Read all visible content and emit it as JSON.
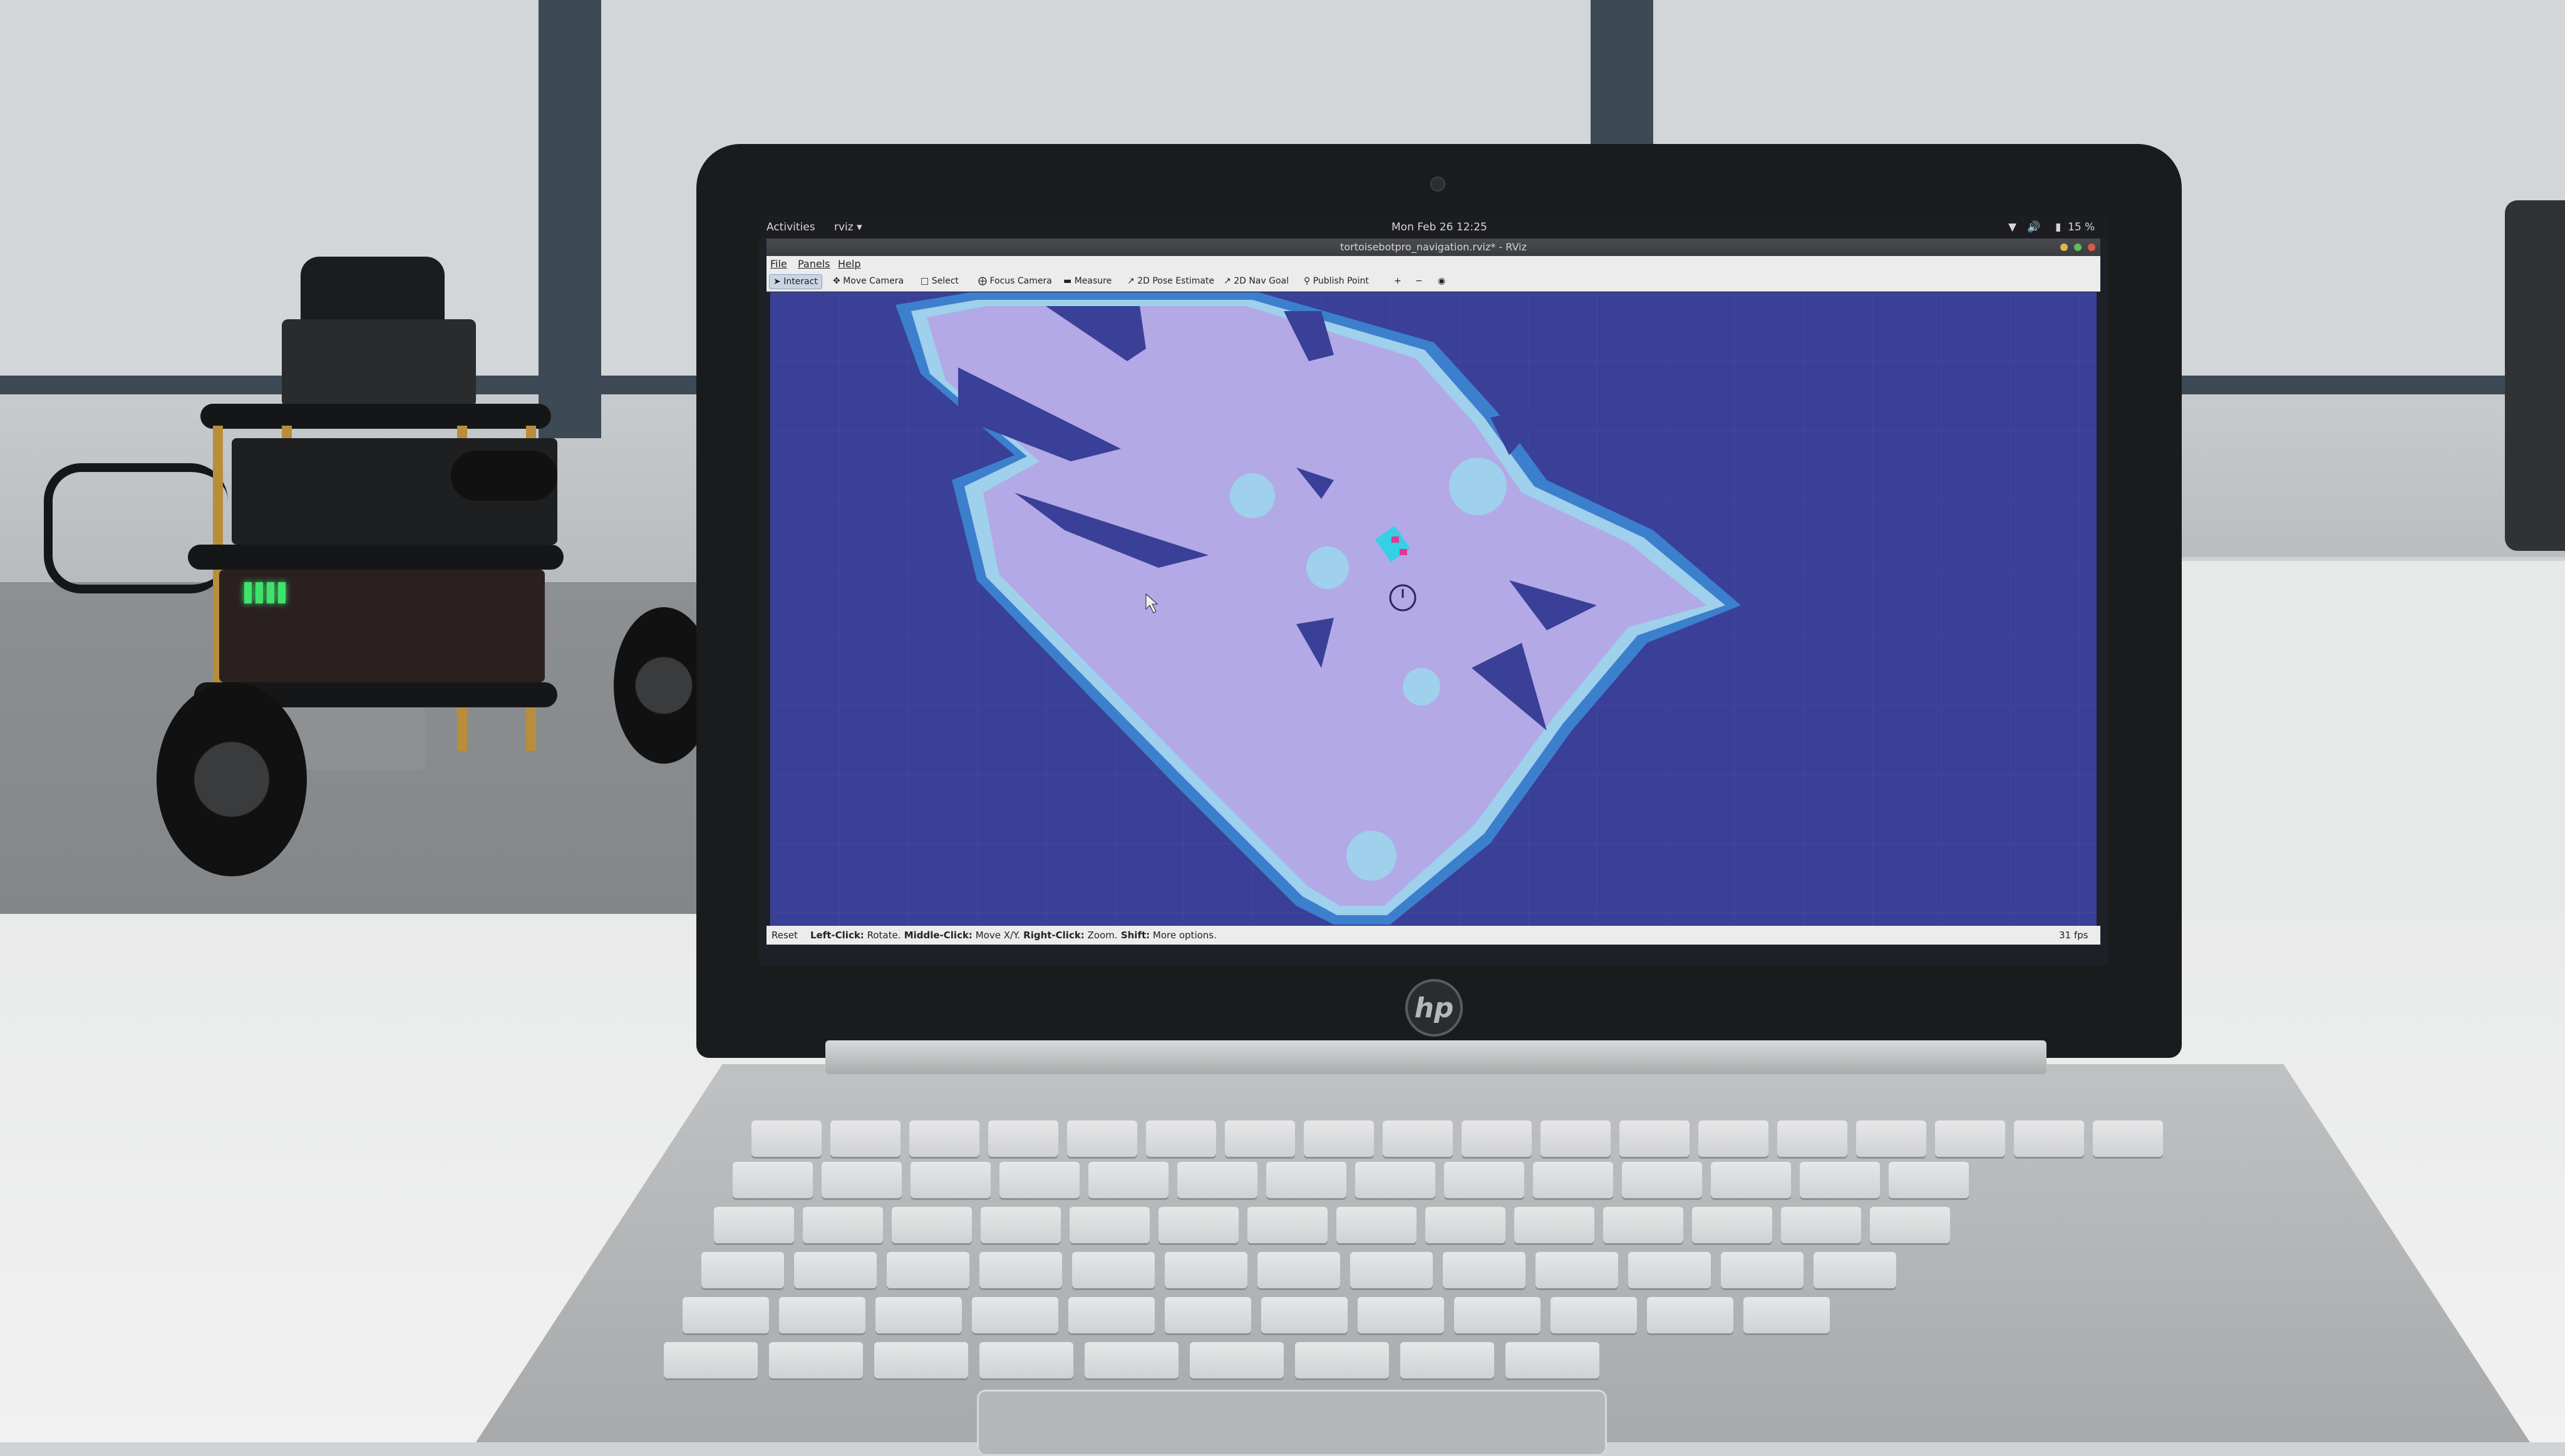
{
  "topbar": {
    "activities": "Activities",
    "app_menu": "rviz ▾",
    "clock": "Mon Feb 26  12:25",
    "battery": "15 %"
  },
  "window": {
    "title": "tortoisebotpro_navigation.rviz* - RViz"
  },
  "menu": {
    "file": "File",
    "panels": "Panels",
    "help": "Help"
  },
  "toolbar": {
    "interact": "Interact",
    "move_camera": "Move Camera",
    "select": "Select",
    "focus_camera": "Focus Camera",
    "measure": "Measure",
    "pose_estimate": "2D Pose Estimate",
    "nav_goal": "2D Nav Goal",
    "publish_point": "Publish Point",
    "plus": "+",
    "minus": "−"
  },
  "status": {
    "reset": "Reset",
    "left_click": "Left-Click:",
    "left_action": " Rotate.",
    "middle_click": " Middle-Click:",
    "middle_action": " Move X/Y.",
    "right_click": " Right-Click:",
    "right_action": " Zoom.",
    "shift": " Shift:",
    "shift_action": " More options.",
    "fps": "31 fps"
  },
  "laptop": {
    "brand": "hp"
  },
  "colors": {
    "map_background": "#3a3f98",
    "free_space": "#b2a9e6",
    "costmap_inflation": "#3d86d3",
    "costmap_inscribed": "#9fd0ec",
    "robot_footprint": "#35d0e6"
  }
}
